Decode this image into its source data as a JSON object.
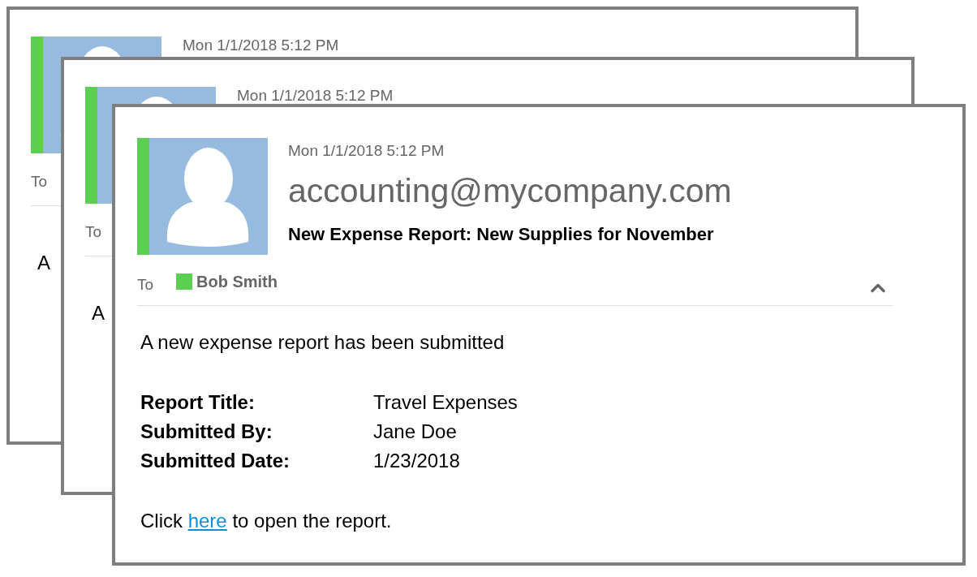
{
  "stack": [
    {
      "date": "Mon 1/1/2018 5:12 PM",
      "to_label": "To",
      "body_excerpt": "A"
    },
    {
      "date": "Mon 1/1/2018 5:12 PM",
      "to_label": "To",
      "body_excerpt": "A"
    }
  ],
  "email": {
    "date": "Mon 1/1/2018 5:12 PM",
    "sender": "accounting@mycompany.com",
    "subject": "New Expense Report: New Supplies for November",
    "to_label": "To",
    "recipient": "Bob Smith",
    "intro": "A new expense report has been submitted",
    "details": [
      {
        "label": "Report Title:",
        "value": "Travel Expenses"
      },
      {
        "label": "Submitted By:",
        "value": "Jane Doe"
      },
      {
        "label": "Submitted Date:",
        "value": "1/23/2018"
      }
    ],
    "footer": {
      "before": "Click",
      "link": "here",
      "after": "to open the report."
    }
  }
}
